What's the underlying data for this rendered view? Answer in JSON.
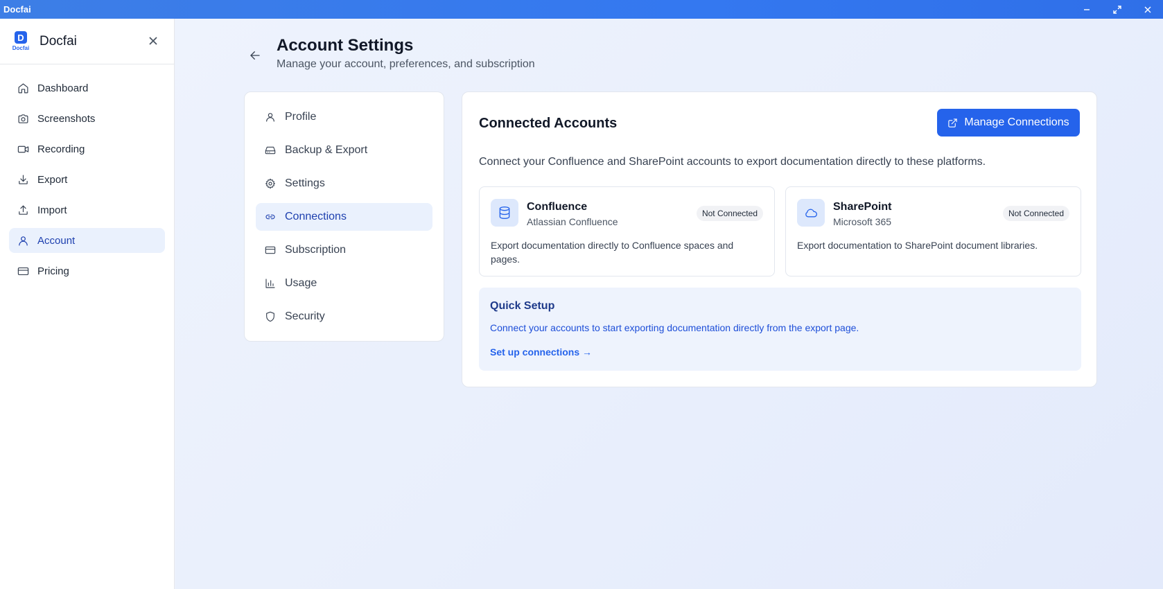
{
  "window": {
    "title": "Docfai"
  },
  "sidebar": {
    "brand": "Docfai",
    "logo_text": "Docfai",
    "logo_letter": "D",
    "items": [
      {
        "label": "Dashboard",
        "icon": "home-icon"
      },
      {
        "label": "Screenshots",
        "icon": "camera-icon"
      },
      {
        "label": "Recording",
        "icon": "video-icon"
      },
      {
        "label": "Export",
        "icon": "download-icon"
      },
      {
        "label": "Import",
        "icon": "upload-icon"
      },
      {
        "label": "Account",
        "icon": "user-icon",
        "active": true
      },
      {
        "label": "Pricing",
        "icon": "credit-card-icon"
      }
    ]
  },
  "header": {
    "title": "Account Settings",
    "subtitle": "Manage your account, preferences, and subscription"
  },
  "settings_nav": {
    "items": [
      {
        "label": "Profile",
        "icon": "user-icon"
      },
      {
        "label": "Backup & Export",
        "icon": "hard-drive-icon"
      },
      {
        "label": "Settings",
        "icon": "gear-icon"
      },
      {
        "label": "Connections",
        "icon": "link-icon",
        "active": true
      },
      {
        "label": "Subscription",
        "icon": "credit-card-icon"
      },
      {
        "label": "Usage",
        "icon": "bar-chart-icon"
      },
      {
        "label": "Security",
        "icon": "shield-icon"
      }
    ]
  },
  "connections": {
    "title": "Connected Accounts",
    "manage_label": "Manage Connections",
    "description": "Connect your Confluence and SharePoint accounts to export documentation directly to these platforms.",
    "accounts": [
      {
        "name": "Confluence",
        "provider": "Atlassian Confluence",
        "status": "Not Connected",
        "description": "Export documentation directly to Confluence spaces and pages.",
        "icon": "database-icon"
      },
      {
        "name": "SharePoint",
        "provider": "Microsoft 365",
        "status": "Not Connected",
        "description": "Export documentation to SharePoint document libraries.",
        "icon": "cloud-icon"
      }
    ],
    "quick_setup": {
      "title": "Quick Setup",
      "description": "Connect your accounts to start exporting documentation directly from the export page.",
      "link_label": "Set up connections →"
    }
  },
  "colors": {
    "accent": "#2563eb",
    "active_bg": "#eaf1fd",
    "titlebar": "#3478f0"
  }
}
